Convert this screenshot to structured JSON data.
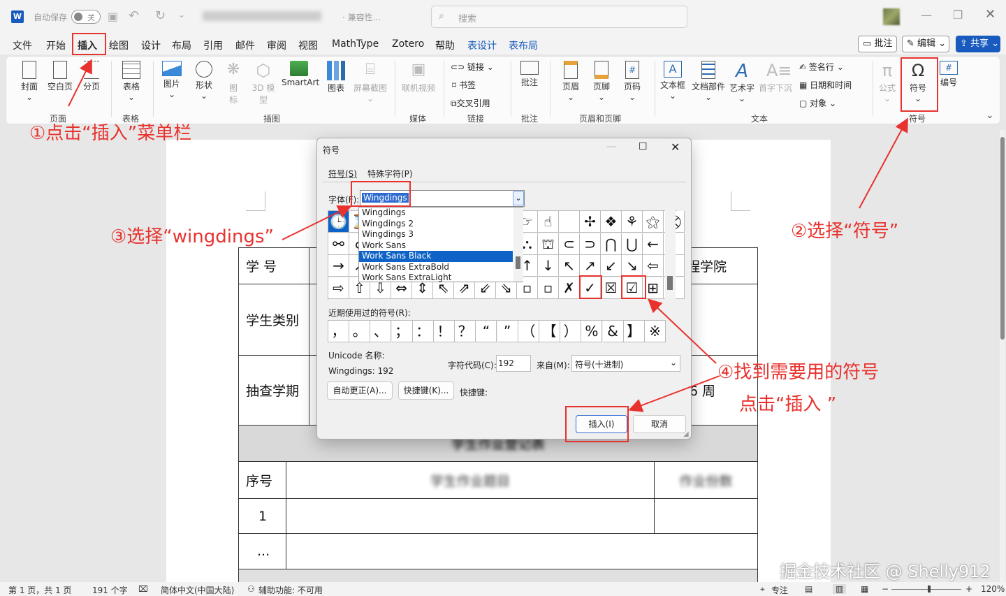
{
  "titlebar": {
    "autosave": "自动保存",
    "toggle": "关",
    "filename": "· 兼容性...",
    "search_placeholder": "搜索"
  },
  "menu": [
    "文件",
    "开始",
    "插入",
    "绘图",
    "设计",
    "布局",
    "引用",
    "邮件",
    "审阅",
    "视图",
    "MathType",
    "Zotero",
    "帮助",
    "表设计",
    "表布局"
  ],
  "menu_right": {
    "comments": "批注",
    "edit": "编辑",
    "share": "共享"
  },
  "ribbon": {
    "buttons": [
      "封面",
      "空白页",
      "分页",
      "表格",
      "图片",
      "形状",
      "图标",
      "3D 模型",
      "SmartArt",
      "图表",
      "屏幕截图",
      "联机视频",
      "链接",
      "书签",
      "交叉引用",
      "批注",
      "页眉",
      "页脚",
      "页码",
      "文本框",
      "文档部件",
      "艺术字",
      "首字下沉",
      "签名行",
      "日期和时间",
      "对象",
      "公式",
      "符号",
      "编号"
    ],
    "groups": [
      "页面",
      "表格",
      "插图",
      "媒体",
      "链接",
      "批注",
      "页眉和页脚",
      "文本",
      "符号"
    ]
  },
  "annotations": {
    "a1": "①点击“插入”菜单栏",
    "a2": "②选择“符号”",
    "a3": "③选择“wingdings”",
    "a4": "④找到需要用的符号",
    "a4b": "点击“插入 ”"
  },
  "document": {
    "row1_label": "学 号",
    "row1_right": "程学院",
    "row2_label": "学生类别",
    "row3_label": "抽查学期",
    "row3_right": "6 周",
    "section_title": "学生作业登记表",
    "col_headers": [
      "序号",
      "学生作业题目",
      "作业份数"
    ],
    "rows": [
      "1",
      "..."
    ]
  },
  "dialog": {
    "title": "符号",
    "tab1": "符号(S)",
    "tab2": "特殊字符(P)",
    "font_label": "字体(F):",
    "font_value": "Wingdings",
    "font_options": [
      "Wingdings",
      "Wingdings 2",
      "Wingdings 3",
      "Work Sans",
      "Work Sans Black",
      "Work Sans ExtraBold",
      "Work Sans ExtraLight"
    ],
    "selected_option": "Work Sans Black",
    "symbols_rows": [
      [
        "🕒",
        "⌛",
        "",
        "",
        "",
        "",
        "",
        "",
        "",
        "☞",
        "☝",
        "",
        "✢",
        "❖",
        "⚘",
        "⚝",
        "⛒"
      ],
      [
        "⚯",
        "☌",
        "",
        "",
        "",
        "",
        "",
        "",
        "",
        "⛬",
        "⛫",
        "⊂",
        "⊃",
        "⋂",
        "⋃",
        "←",
        ""
      ],
      [
        "→",
        "↗",
        "",
        "",
        "",
        "",
        "",
        "",
        "",
        "↑",
        "↓",
        "↖",
        "↗",
        "↙",
        "↘",
        "⇦",
        ""
      ],
      [
        "⇨",
        "⇧",
        "⇩",
        "⇔",
        "⇕",
        "⇖",
        "⇗",
        "⇙",
        "⇘",
        "▫",
        "▫",
        "✗",
        "✓",
        "☒",
        "☑",
        "⊞",
        ""
      ]
    ],
    "recent_label": "近期使用过的符号(R):",
    "recent": [
      "，",
      "。",
      "、",
      "；",
      "：",
      "！",
      "？",
      "“",
      "”",
      "（",
      "【",
      "）",
      "%",
      "&",
      "】",
      "※"
    ],
    "unicode_label": "Unicode 名称:",
    "char_name": "Wingdings: 192",
    "code_label": "字符代码(C):",
    "code_value": "192",
    "from_label": "来自(M):",
    "from_value": "符号(十进制)",
    "autocorrect": "自动更正(A)...",
    "shortcut_btn": "快捷键(K)...",
    "shortcut_label": "快捷键:",
    "insert": "插入(I)",
    "cancel": "取消"
  },
  "status": {
    "page": "第 1 页，共 1 页",
    "words": "191 个字",
    "lang": "简体中文(中国大陆)",
    "access": "辅助功能: 不可用",
    "focus": "专注",
    "zoom": "120%"
  },
  "watermark": "掘金技术社区 @ Shelly912",
  "colors": {
    "accent": "#185abd",
    "red": "#e8322e"
  }
}
